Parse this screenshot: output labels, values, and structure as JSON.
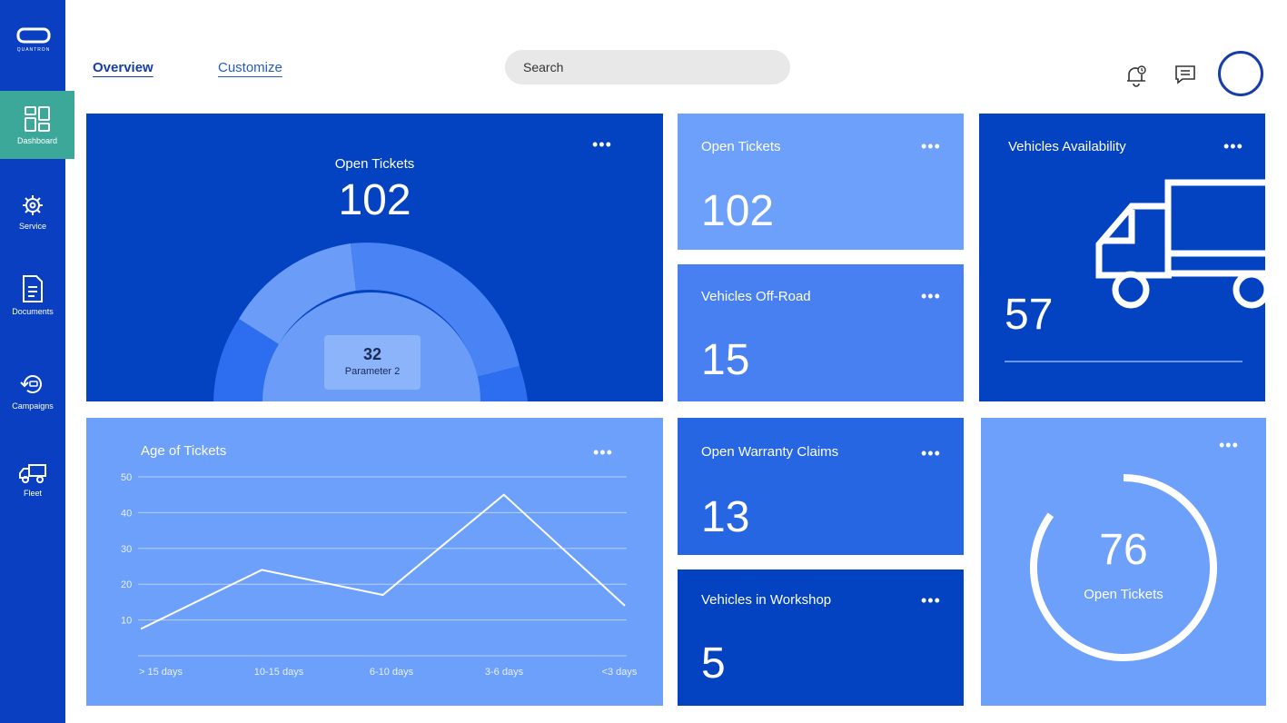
{
  "brand": {
    "logo_text": "QUANTRON"
  },
  "sidebar": {
    "items": [
      {
        "label": "Dashboard",
        "icon": "dashboard-icon",
        "active": true
      },
      {
        "label": "Service",
        "icon": "service-icon"
      },
      {
        "label": "Documents",
        "icon": "documents-icon"
      },
      {
        "label": "Campaigns",
        "icon": "campaigns-icon"
      },
      {
        "label": "Fleet",
        "icon": "fleet-icon"
      }
    ]
  },
  "header": {
    "tabs": [
      {
        "label": "Overview"
      },
      {
        "label": "Customize"
      }
    ],
    "search": {
      "value": "Search"
    },
    "icons": [
      "notification-bell-icon",
      "chat-icon",
      "avatar"
    ]
  },
  "colors": {
    "sidebar": "#0a3fc2",
    "active": "#3ba89a",
    "dark": "#0342c0",
    "light": "#6da0fa",
    "mid": "#4880f2"
  },
  "cards": {
    "donut": {
      "title": "Open Tickets",
      "value": "102",
      "tooltip_value": "32",
      "tooltip_label": "Parameter 2"
    },
    "open_tickets": {
      "title": "Open Tickets",
      "value": "102"
    },
    "off_road": {
      "title": "Vehicles Off-Road",
      "value": "15"
    },
    "availability": {
      "title": "Vehicles Availability",
      "value": "57"
    },
    "warranty": {
      "title": "Open Warranty Claims",
      "value": "13"
    },
    "workshop": {
      "title": "Vehicles in Workshop",
      "value": "5"
    },
    "ring": {
      "value": "76",
      "label": "Open Tickets",
      "progress": 0.85
    },
    "age": {
      "title": "Age of Tickets"
    }
  },
  "chart_data": {
    "type": "line",
    "title": "Age of Tickets",
    "categories": [
      "> 15 days",
      "10-15 days",
      "6-10 days",
      "3-6 days",
      "<3 days"
    ],
    "x_positions": [
      0,
      1,
      2,
      3,
      4
    ],
    "values": [
      7.5,
      24,
      17,
      45,
      14
    ],
    "y_ticks": [
      10,
      20,
      30,
      40,
      50
    ],
    "ylim": [
      0,
      50
    ],
    "grid": true
  },
  "menu": {
    "dots": "•••"
  }
}
